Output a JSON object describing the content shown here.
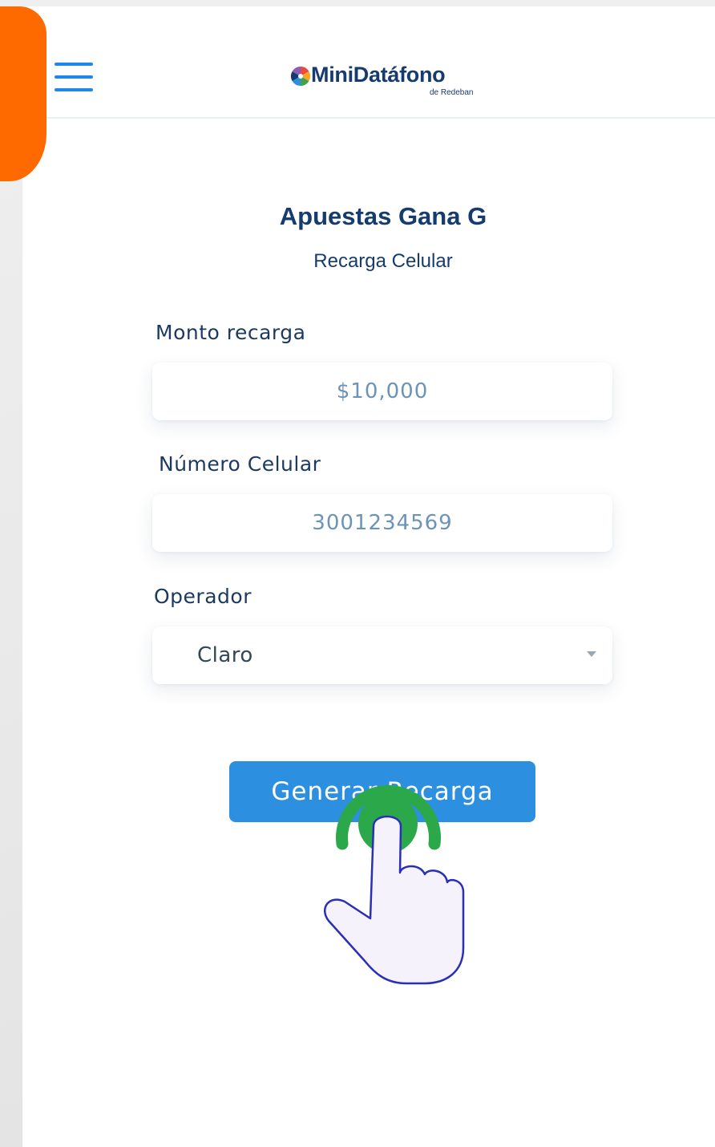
{
  "colors": {
    "accent_orange": "#ff6a00",
    "primary_blue": "#2d8fe0",
    "heading_navy": "#163b6e",
    "tap_green": "#2aa84a"
  },
  "header": {
    "menu_icon": "hamburger-menu-icon",
    "logo_text": "MiniDatáfono",
    "logo_subtext": "de Redeban"
  },
  "page": {
    "merchant_name": "Apuestas Gana G",
    "service_name": "Recarga Celular"
  },
  "form": {
    "amount": {
      "label": "Monto recarga",
      "value": "$10,000"
    },
    "phone": {
      "label": "Número Celular",
      "value": "3001234569"
    },
    "operator": {
      "label": "Operador",
      "selected": "Claro",
      "icon": "caret-down-icon"
    },
    "submit_label": "Generar Recarga"
  },
  "overlay": {
    "icon": "tap-hand-icon"
  }
}
